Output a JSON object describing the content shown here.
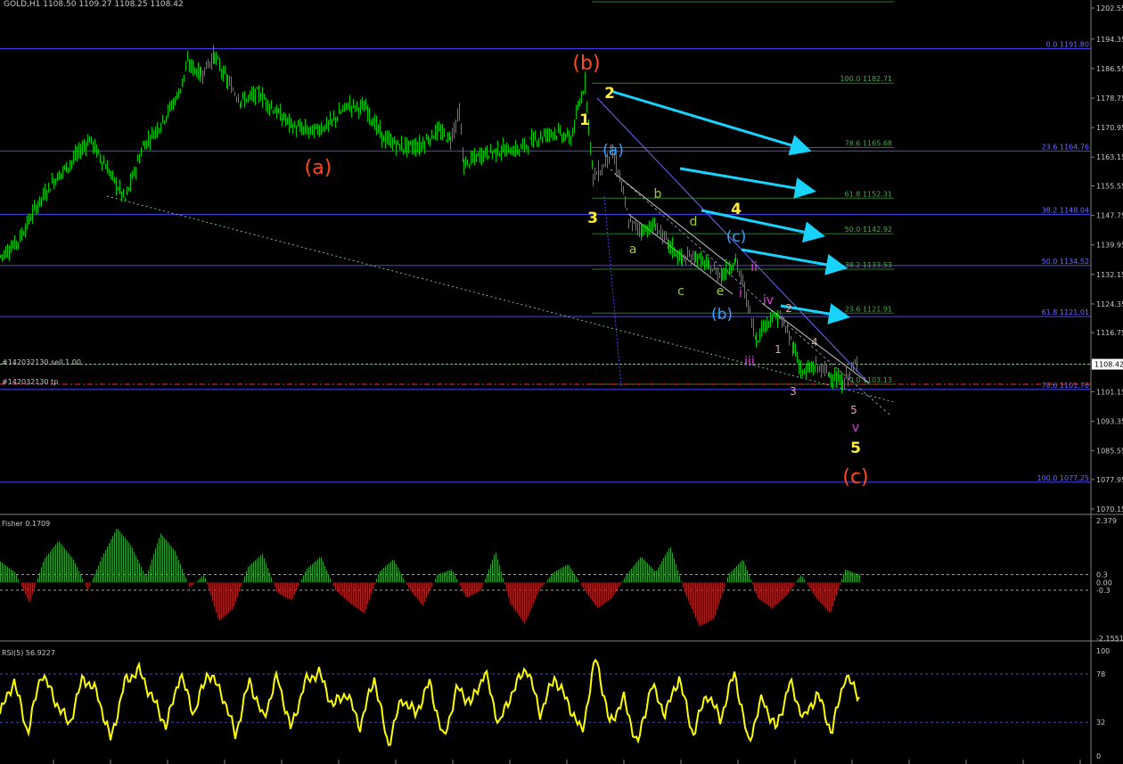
{
  "header": {
    "symbol": "GOLD,H1",
    "ohlc": "1108.50 1109.27 1108.25 1108.42"
  },
  "colors": {
    "background": "#000000",
    "candle": "#00c800",
    "blue_line": "#4646ff",
    "green_fib": "#2a7a2a",
    "cyan_arrow": "#19d3ff",
    "orange_label": "#ff4b1e",
    "yellow_label": "#ffee33",
    "olive_label": "#9acd32",
    "blue_label": "#3aa0ff",
    "magenta_label": "#e040e0",
    "pink_label": "#e8a0a0",
    "fisher_pos": "#2ea02e",
    "fisher_neg": "#b01e1e",
    "rsi_line": "#ffff00",
    "axis_text": "#c8c8c8"
  },
  "main_axis": {
    "ticks": [
      "1202.55",
      "1194.35",
      "1186.55",
      "1178.75",
      "1170.95",
      "1163.15",
      "1155.55",
      "1147.75",
      "1139.95",
      "1132.15",
      "1124.35",
      "1116.75",
      "1108.95",
      "1101.15",
      "1093.35",
      "1085.55",
      "1077.95",
      "1070.15"
    ],
    "current_price": "1108.42"
  },
  "fib_blue_labels": [
    {
      "text": "0.0 1191.80",
      "price": 1191.8
    },
    {
      "text": "23.6 1164.76",
      "price": 1164.76
    },
    {
      "text": "38.2 1148.04",
      "price": 1148.04
    },
    {
      "text": "50.0 1134.52",
      "price": 1134.52
    },
    {
      "text": "61.8 1121.01",
      "price": 1121.01
    },
    {
      "text": "78.6 1101.76",
      "price": 1101.76
    },
    {
      "text": "100.0 1077.25",
      "price": 1077.25
    }
  ],
  "fib_green_labels": [
    {
      "text": "100.0 1182.71",
      "price": 1182.71
    },
    {
      "text": "78.6 1165.68",
      "price": 1165.68
    },
    {
      "text": "61.8 1152.31",
      "price": 1152.31
    },
    {
      "text": "50.0 1142.92",
      "price": 1142.92
    },
    {
      "text": "38.2 1133.53",
      "price": 1133.53
    },
    {
      "text": "23.6 1121.91",
      "price": 1121.91
    },
    {
      "text": "0.0 1103.13",
      "price": 1103.13
    }
  ],
  "order_lines": {
    "sell": "#142032130 sell 1.00",
    "tp": "#142032130 tp"
  },
  "wave_labels": [
    {
      "text": "(b)",
      "color": "orange_label",
      "size": "big"
    },
    {
      "text": "(a)",
      "color": "orange_label",
      "size": "big"
    },
    {
      "text": "(c)",
      "color": "orange_label",
      "size": "big"
    },
    {
      "text": "1",
      "color": "yellow_label",
      "size": "med"
    },
    {
      "text": "2",
      "color": "yellow_label",
      "size": "med"
    },
    {
      "text": "3",
      "color": "yellow_label",
      "size": "med"
    },
    {
      "text": "4",
      "color": "yellow_label",
      "size": "med"
    },
    {
      "text": "5",
      "color": "yellow_label",
      "size": "med"
    },
    {
      "text": "(a)",
      "color": "blue_label",
      "size": "med"
    },
    {
      "text": "(b)",
      "color": "blue_label",
      "size": "med"
    },
    {
      "text": "(c)",
      "color": "blue_label",
      "size": "med"
    },
    {
      "text": "a",
      "color": "olive_label",
      "size": "small"
    },
    {
      "text": "b",
      "color": "olive_label",
      "size": "small"
    },
    {
      "text": "c",
      "color": "olive_label",
      "size": "small"
    },
    {
      "text": "d",
      "color": "olive_label",
      "size": "small"
    },
    {
      "text": "e",
      "color": "olive_label",
      "size": "small"
    },
    {
      "text": "i",
      "color": "magenta_label",
      "size": "small"
    },
    {
      "text": "ii",
      "color": "magenta_label",
      "size": "small"
    },
    {
      "text": "iii",
      "color": "magenta_label",
      "size": "small"
    },
    {
      "text": "iv",
      "color": "magenta_label",
      "size": "small"
    },
    {
      "text": "v",
      "color": "magenta_label",
      "size": "small"
    },
    {
      "text": "1",
      "color": "pink_label",
      "size": "tiny"
    },
    {
      "text": "2",
      "color": "pink_label",
      "size": "tiny"
    },
    {
      "text": "3",
      "color": "pink_label",
      "size": "tiny"
    },
    {
      "text": "4",
      "color": "pink_label",
      "size": "tiny"
    },
    {
      "text": "5",
      "color": "pink_label",
      "size": "tiny"
    }
  ],
  "fisher": {
    "title": "Fisher 0.1709",
    "ticks": [
      "2.379",
      "0.3",
      "0.00",
      "-0.3",
      "-2.1551"
    ],
    "range": [
      -2.1551,
      2.379
    ]
  },
  "rsi": {
    "title": "RSI(5) 56.9227",
    "ticks": [
      "100",
      "78",
      "32",
      "0"
    ],
    "range": [
      0,
      100
    ]
  },
  "chart_data": {
    "type": "line",
    "title": "GOLD,H1",
    "price_range": [
      1070.15,
      1202.55
    ],
    "price_path": [
      [
        0,
        1137
      ],
      [
        20,
        1141
      ],
      [
        40,
        1150
      ],
      [
        60,
        1157
      ],
      [
        80,
        1162
      ],
      [
        100,
        1168
      ],
      [
        120,
        1160
      ],
      [
        140,
        1152
      ],
      [
        160,
        1166
      ],
      [
        180,
        1172
      ],
      [
        200,
        1180
      ],
      [
        210,
        1188
      ],
      [
        225,
        1185
      ],
      [
        240,
        1190
      ],
      [
        255,
        1183
      ],
      [
        270,
        1178
      ],
      [
        290,
        1180
      ],
      [
        310,
        1175
      ],
      [
        330,
        1171
      ],
      [
        350,
        1170
      ],
      [
        370,
        1172
      ],
      [
        390,
        1177
      ],
      [
        410,
        1176
      ],
      [
        430,
        1168
      ],
      [
        450,
        1166
      ],
      [
        470,
        1166
      ],
      [
        490,
        1170
      ],
      [
        505,
        1168
      ],
      [
        515,
        1175
      ],
      [
        520,
        1161
      ],
      [
        540,
        1164
      ],
      [
        560,
        1165
      ],
      [
        580,
        1165
      ],
      [
        600,
        1168
      ],
      [
        620,
        1170
      ],
      [
        640,
        1168
      ],
      [
        656,
        1183
      ],
      [
        665,
        1158
      ],
      [
        675,
        1160
      ],
      [
        685,
        1165
      ],
      [
        695,
        1158
      ],
      [
        705,
        1146
      ],
      [
        720,
        1144
      ],
      [
        735,
        1145
      ],
      [
        750,
        1140
      ],
      [
        765,
        1136
      ],
      [
        780,
        1137
      ],
      [
        795,
        1134
      ],
      [
        810,
        1132
      ],
      [
        825,
        1136
      ],
      [
        835,
        1128
      ],
      [
        848,
        1115
      ],
      [
        860,
        1120
      ],
      [
        875,
        1121
      ],
      [
        890,
        1113
      ],
      [
        900,
        1106
      ],
      [
        915,
        1108
      ],
      [
        930,
        1106
      ],
      [
        945,
        1103
      ],
      [
        955,
        1107
      ],
      [
        962,
        1108.42
      ]
    ],
    "fib_levels_blue": [
      1191.8,
      1164.76,
      1148.04,
      1134.52,
      1121.01,
      1101.76,
      1077.25
    ],
    "fib_levels_green": [
      1182.71,
      1165.68,
      1152.31,
      1142.92,
      1133.53,
      1121.91,
      1103.13
    ],
    "fisher_values": [
      0.8,
      0.4,
      -0.8,
      0.9,
      1.6,
      0.9,
      -0.3,
      1.0,
      2.1,
      1.4,
      0.2,
      1.9,
      1.2,
      -0.2,
      0.3,
      -1.5,
      -1.0,
      0.6,
      1.1,
      -0.4,
      -0.7,
      0.5,
      1.0,
      -0.3,
      -0.8,
      -1.2,
      0.4,
      0.9,
      -0.2,
      -0.9,
      0.3,
      0.5,
      -0.6,
      -0.3,
      1.2,
      -0.8,
      -1.6,
      -0.3,
      0.4,
      0.7,
      -0.2,
      -1.0,
      -0.6,
      0.3,
      1.0,
      0.4,
      1.4,
      -0.4,
      -1.7,
      -1.4,
      0.3,
      0.9,
      -0.6,
      -1.0,
      -0.5,
      0.3,
      -0.6,
      -1.2,
      0.5,
      0.3
    ],
    "rsi_values": [
      40,
      72,
      22,
      80,
      52,
      30,
      75,
      60,
      15,
      70,
      82,
      55,
      28,
      78,
      40,
      80,
      60,
      20,
      72,
      35,
      76,
      25,
      70,
      80,
      48,
      60,
      28,
      75,
      10,
      55,
      40,
      70,
      15,
      65,
      50,
      80,
      30,
      62,
      85,
      40,
      75,
      50,
      22,
      95,
      30,
      55,
      10,
      68,
      40,
      75,
      20,
      60,
      35,
      80,
      12,
      55,
      25,
      70,
      35,
      60,
      22,
      77,
      56.9
    ]
  }
}
